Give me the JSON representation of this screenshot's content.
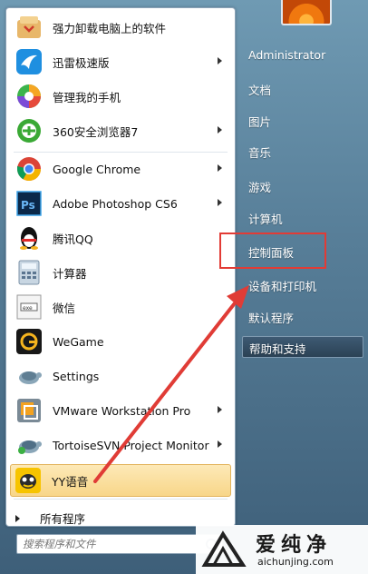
{
  "left_menu": {
    "items": [
      {
        "label": "强力卸载电脑上的软件",
        "icon": "uninstaller-icon",
        "arrow": false
      },
      {
        "label": "迅雷极速版",
        "icon": "xunlei-bird-icon",
        "arrow": true
      },
      {
        "label": "管理我的手机",
        "icon": "phone-manager-icon",
        "arrow": false
      },
      {
        "label": "360安全浏览器7",
        "icon": "360-browser-icon",
        "arrow": true
      },
      {
        "label": "Google Chrome",
        "icon": "chrome-icon",
        "arrow": true
      },
      {
        "label": "Adobe Photoshop CS6",
        "icon": "photoshop-icon",
        "arrow": true
      },
      {
        "label": "腾讯QQ",
        "icon": "qq-penguin-icon",
        "arrow": false
      },
      {
        "label": "计算器",
        "icon": "calculator-icon",
        "arrow": false
      },
      {
        "label": "微信",
        "icon": "wechat-icon",
        "arrow": false
      },
      {
        "label": "WeGame",
        "icon": "wegame-icon",
        "arrow": false
      },
      {
        "label": "Settings",
        "icon": "settings-turtle-icon",
        "arrow": false
      },
      {
        "label": "VMware Workstation Pro",
        "icon": "vmware-icon",
        "arrow": true
      },
      {
        "label": "TortoiseSVN Project Monitor",
        "icon": "tortoisesvn-icon",
        "arrow": true
      },
      {
        "label": "YY语音",
        "icon": "yy-voice-icon",
        "arrow": false
      }
    ],
    "all_programs": "所有程序",
    "search_placeholder": "搜索程序和文件"
  },
  "right_menu": {
    "user": "Administrator",
    "documents": "文档",
    "pictures": "图片",
    "music": "音乐",
    "games": "游戏",
    "computer": "计算机",
    "control_panel": "控制面板",
    "devices_printers": "设备和打印机",
    "default_programs": "默认程序",
    "help_support": "帮助和支持"
  },
  "watermark": {
    "text": "爱纯净",
    "url": "aichunjing.com"
  },
  "colors": {
    "highlight_box": "#e23b35",
    "annotation_arrow": "#e03c36"
  }
}
